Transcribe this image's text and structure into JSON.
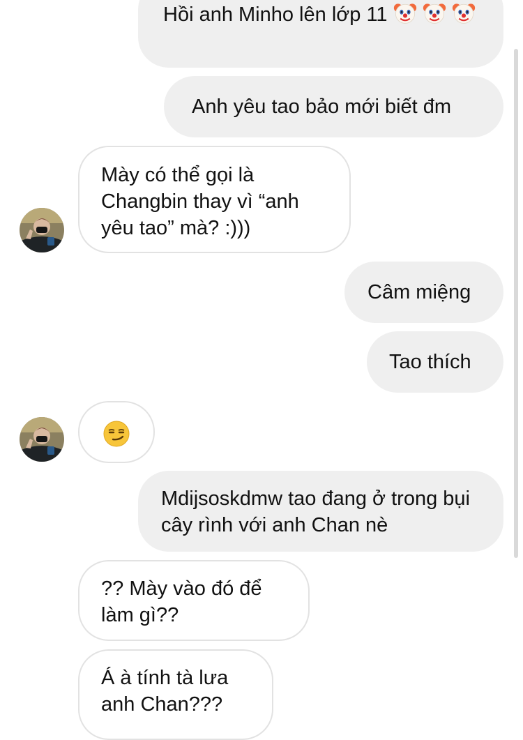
{
  "messages": {
    "m1": {
      "text": "Hồi anh Minho lên lớp 11",
      "emoji": "clown-face"
    },
    "m2": {
      "text": "Anh yêu tao bảo mới biết đm"
    },
    "m3": {
      "text": "Mày có thể gọi là Changbin thay vì “anh yêu tao” mà? :)))"
    },
    "m4": {
      "text": "Câm miệng"
    },
    "m5": {
      "text": "Tao thích"
    },
    "m6": {
      "emoji": "smirking-face"
    },
    "m7": {
      "text": "Mdijsoskdmw tao đang ở trong bụi cây rình với anh Chan nè"
    },
    "m8": {
      "text": "?? Mày vào đó để làm gì??"
    },
    "m9": {
      "text": "Á à tính tà lưa anh Chan???"
    }
  },
  "colors": {
    "outgoing_bubble": "#efefef",
    "incoming_border": "#e2e2e2",
    "text": "#111111"
  }
}
